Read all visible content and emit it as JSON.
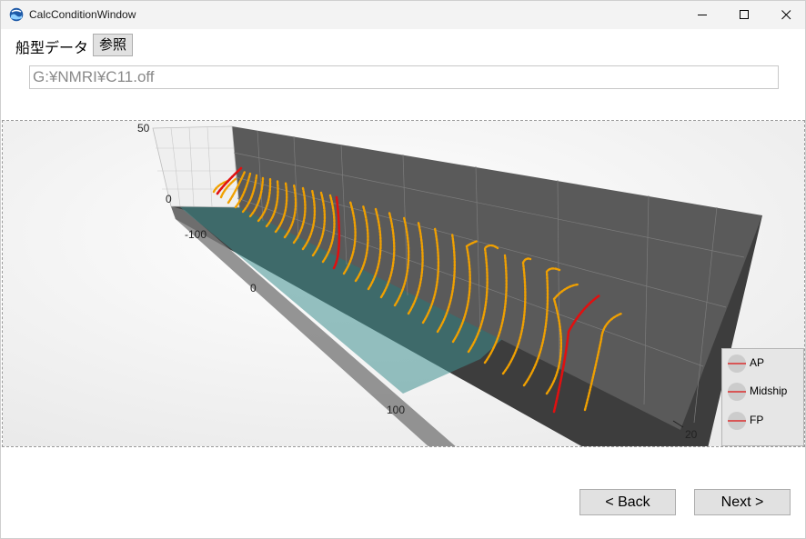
{
  "window": {
    "title": "CalcConditionWindow"
  },
  "form": {
    "ship_label": "船型データ",
    "ref_button": "参照",
    "path_value": "G:¥NMRI¥C11.off"
  },
  "viewport": {
    "axis_labels": {
      "z_top": "50",
      "z_zero": "0",
      "y_m100": "-100",
      "y_0": "0",
      "y_100": "100",
      "x_20": "20"
    },
    "colors": {
      "stations": "#f0a000",
      "highlight": "#e01010",
      "walls": "#5a5a5a",
      "floor": "#3d3d3d",
      "water": "#3f8f8f"
    }
  },
  "legend": {
    "items": [
      {
        "label": "AP"
      },
      {
        "label": "Midship"
      },
      {
        "label": "FP"
      }
    ]
  },
  "buttons": {
    "back": "< Back",
    "next": "Next >"
  }
}
